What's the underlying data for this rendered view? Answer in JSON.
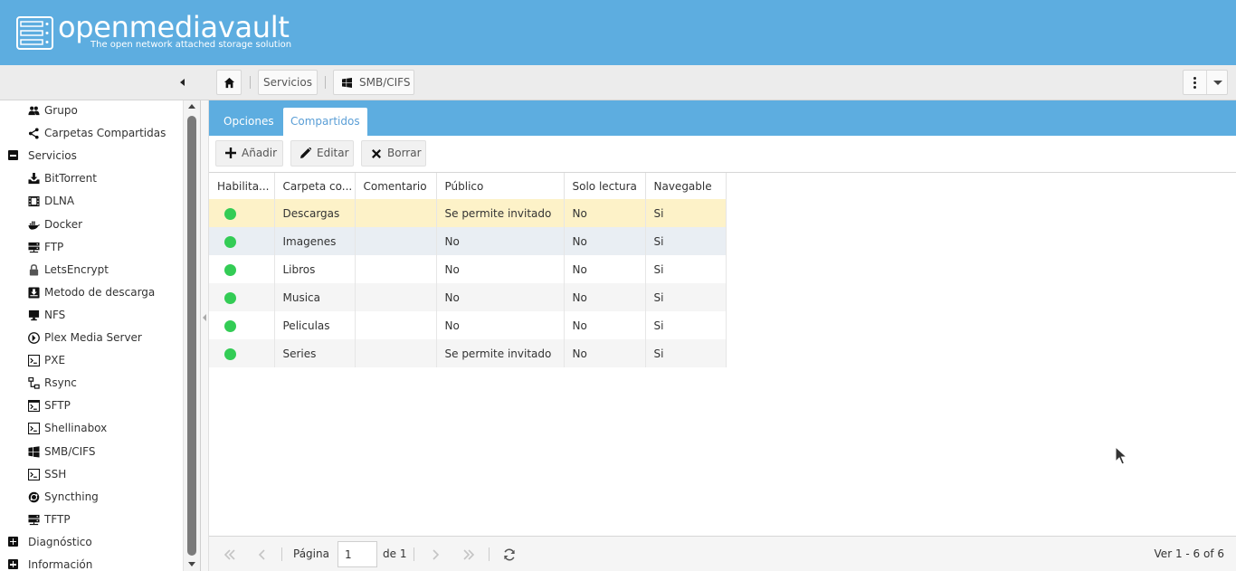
{
  "app": {
    "logo_text": "openmediavault",
    "logo_subtitle": "The open network attached storage solution"
  },
  "breadcrumb": {
    "home_icon": "home-icon",
    "items": [
      "Servicios",
      "SMB/CIFS"
    ],
    "smb_icon": "windows-icon"
  },
  "sidebar": {
    "items": [
      {
        "label": "Grupo",
        "icon": "group-icon",
        "level": "child"
      },
      {
        "label": "Carpetas Compartidas",
        "icon": "share-icon",
        "level": "child"
      },
      {
        "label": "Servicios",
        "icon": "collapse-icon",
        "level": "parent"
      },
      {
        "label": "BitTorrent",
        "icon": "download-icon",
        "level": "child"
      },
      {
        "label": "DLNA",
        "icon": "film-icon",
        "level": "child"
      },
      {
        "label": "Docker",
        "icon": "docker-icon",
        "level": "child"
      },
      {
        "label": "FTP",
        "icon": "server-icon",
        "level": "child"
      },
      {
        "label": "LetsEncrypt",
        "icon": "lock-icon",
        "level": "child"
      },
      {
        "label": "Metodo de descarga",
        "icon": "inbox-download-icon",
        "level": "child"
      },
      {
        "label": "NFS",
        "icon": "desktop-icon",
        "level": "child"
      },
      {
        "label": "Plex Media Server",
        "icon": "plex-icon",
        "level": "child"
      },
      {
        "label": "PXE",
        "icon": "terminal-icon",
        "level": "child"
      },
      {
        "label": "Rsync",
        "icon": "sitemap-icon",
        "level": "child"
      },
      {
        "label": "SFTP",
        "icon": "terminal-window-icon",
        "level": "child"
      },
      {
        "label": "Shellinabox",
        "icon": "terminal-icon",
        "level": "child"
      },
      {
        "label": "SMB/CIFS",
        "icon": "windows-icon",
        "level": "child"
      },
      {
        "label": "SSH",
        "icon": "terminal-icon",
        "level": "child"
      },
      {
        "label": "Syncthing",
        "icon": "sync-icon",
        "level": "child"
      },
      {
        "label": "TFTP",
        "icon": "server-icon",
        "level": "child"
      },
      {
        "label": "Diagnóstico",
        "icon": "expand-icon",
        "level": "parent"
      },
      {
        "label": "Información",
        "icon": "expand-icon",
        "level": "parent"
      }
    ]
  },
  "tabs": [
    {
      "label": "Opciones",
      "active": false
    },
    {
      "label": "Compartidos",
      "active": true
    }
  ],
  "toolbar": {
    "add_label": "Añadir",
    "edit_label": "Editar",
    "delete_label": "Borrar"
  },
  "grid": {
    "columns": [
      "Habilita...",
      "Carpeta co...",
      "Comentario",
      "Público",
      "Solo lectura",
      "Navegable"
    ],
    "rows": [
      {
        "enabled": true,
        "folder": "Descargas",
        "comment": "",
        "public": "Se permite invitado",
        "readonly": "No",
        "browseable": "Si"
      },
      {
        "enabled": true,
        "folder": "Imagenes",
        "comment": "",
        "public": "No",
        "readonly": "No",
        "browseable": "Si"
      },
      {
        "enabled": true,
        "folder": "Libros",
        "comment": "",
        "public": "No",
        "readonly": "No",
        "browseable": "Si"
      },
      {
        "enabled": true,
        "folder": "Musica",
        "comment": "",
        "public": "No",
        "readonly": "No",
        "browseable": "Si"
      },
      {
        "enabled": true,
        "folder": "Peliculas",
        "comment": "",
        "public": "No",
        "readonly": "No",
        "browseable": "Si"
      },
      {
        "enabled": true,
        "folder": "Series",
        "comment": "",
        "public": "Se permite invitado",
        "readonly": "No",
        "browseable": "Si"
      }
    ]
  },
  "pager": {
    "page_label": "Página",
    "page_value": "1",
    "of_label": "de 1",
    "info": "Ver 1 - 6 of 6"
  },
  "colors": {
    "header_blue": "#5dade0",
    "enabled_green": "#33cc55",
    "selected_row": "#fdf2c8"
  }
}
